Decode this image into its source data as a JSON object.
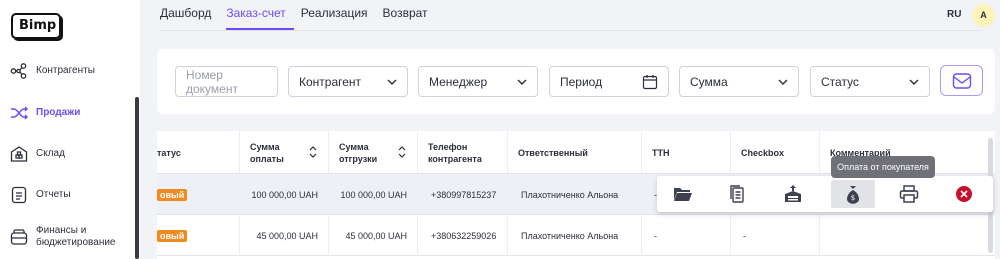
{
  "app": {
    "logo": "Bimp"
  },
  "sidebar": {
    "items": [
      {
        "label": "Контрагенты",
        "icon": "network-icon"
      },
      {
        "label": "Продажи",
        "icon": "shuffle-icon",
        "active": true
      },
      {
        "label": "Склад",
        "icon": "warehouse-icon"
      },
      {
        "label": "Отчеты",
        "icon": "document-icon"
      },
      {
        "label": "Финансы и бюджетирование",
        "icon": "wallet-icon"
      }
    ]
  },
  "topnav": {
    "tabs": [
      "Дашборд",
      "Заказ-счет",
      "Реализация",
      "Возврат"
    ],
    "active_index": 1
  },
  "header": {
    "lang": "RU",
    "avatar": "A"
  },
  "filters": {
    "doc_number_placeholder": "Номер документ",
    "counterparty": "Контрагент",
    "manager": "Менеджер",
    "period": "Период",
    "sum": "Сумма",
    "status": "Статус"
  },
  "table": {
    "columns": [
      "татус",
      "Сумма оплаты",
      "Сумма отгрузки",
      "Телефон контрагента",
      "Ответственный",
      "ТТН",
      "Checkbox",
      "Комментарий"
    ],
    "rows": [
      {
        "status": "овый",
        "paid": "100 000,00 UAH",
        "shipped": "100 000,00 UAH",
        "phone": "+380997815237",
        "responsible": "Плахотниченко Альона",
        "ttn": "-",
        "checkbox": "-"
      },
      {
        "status": "овый",
        "paid": "45 000,00 UAH",
        "shipped": "45 000,00 UAH",
        "phone": "+380632259026",
        "responsible": "Плахотниченко Альона",
        "ttn": "-",
        "checkbox": "-"
      }
    ]
  },
  "actions": {
    "tooltip": "Оплата от покупателя",
    "buttons": [
      "folder-icon",
      "copy-document-icon",
      "ship-out-icon",
      "money-bag-icon",
      "print-icon",
      "delete-icon"
    ]
  },
  "colors": {
    "accent": "#6b4cf6",
    "badge": "#f08a1c",
    "danger": "#c8102e"
  }
}
